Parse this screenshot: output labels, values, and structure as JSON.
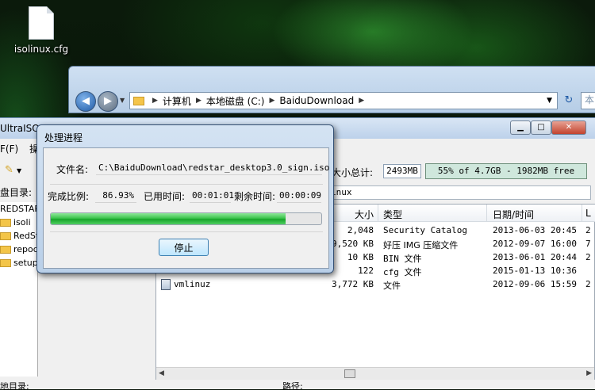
{
  "desktop": {
    "file_label": "isolinux.cfg"
  },
  "explorer": {
    "breadcrumb": [
      "计算机",
      "本地磁盘 (C:)",
      "BaiduDownload"
    ],
    "search_cut": "本"
  },
  "ultraiso": {
    "title": "UltraISO",
    "menu": [
      "F(F)",
      "操"
    ],
    "left_label": "盘目录:",
    "tree_root": "REDSTAR",
    "tree_items": [
      "isoli",
      "RedSt",
      "repod",
      "setup"
    ],
    "size_label": "大小总计:",
    "size_value": "2493MB",
    "capacity_text": "55% of 4.7GB - 1982MB free",
    "path_cut": "inux",
    "columns": {
      "size": "大小",
      "type": "类型",
      "date": "日期/时间",
      "extra": "L"
    },
    "rows": [
      {
        "name": "",
        "size": "2,048",
        "type": "Security Catalog",
        "date": "2013-06-03 20:45",
        "extra": "2"
      },
      {
        "name": "",
        "size": "9,520 KB",
        "type": "好压 IMG 压缩文件",
        "date": "2012-09-07 16:00",
        "extra": "7"
      },
      {
        "name": "",
        "size": "10 KB",
        "type": "BIN 文件",
        "date": "2013-06-01 20:44",
        "extra": "2"
      },
      {
        "name": "",
        "size": "122",
        "type": "cfg 文件",
        "date": "2015-01-13 10:36",
        "extra": ""
      },
      {
        "name": "vmlinuz",
        "size": "3,772 KB",
        "type": "文件",
        "date": "2012-09-06 15:59",
        "extra": "2"
      }
    ],
    "bottom_left": "地目录:",
    "bottom_path_label": "路径:"
  },
  "dialog": {
    "title": "处理进程",
    "filename_label": "文件名:",
    "filename_value": "C:\\BaiduDownload\\redstar_desktop3.0_sign.iso",
    "complete_label": "完成比例:",
    "complete_value": "86.93%",
    "elapsed_label": "已用时间:",
    "elapsed_value": "00:01:01",
    "remaining_label": "剩余时间:",
    "remaining_value": "00:00:09",
    "progress_percent": 86.93,
    "stop_label": "停止"
  },
  "colors": {
    "progress_green": "#17a42a",
    "capacity_bar": "#cfe7dc",
    "title_bar": "#bcd1ea"
  }
}
